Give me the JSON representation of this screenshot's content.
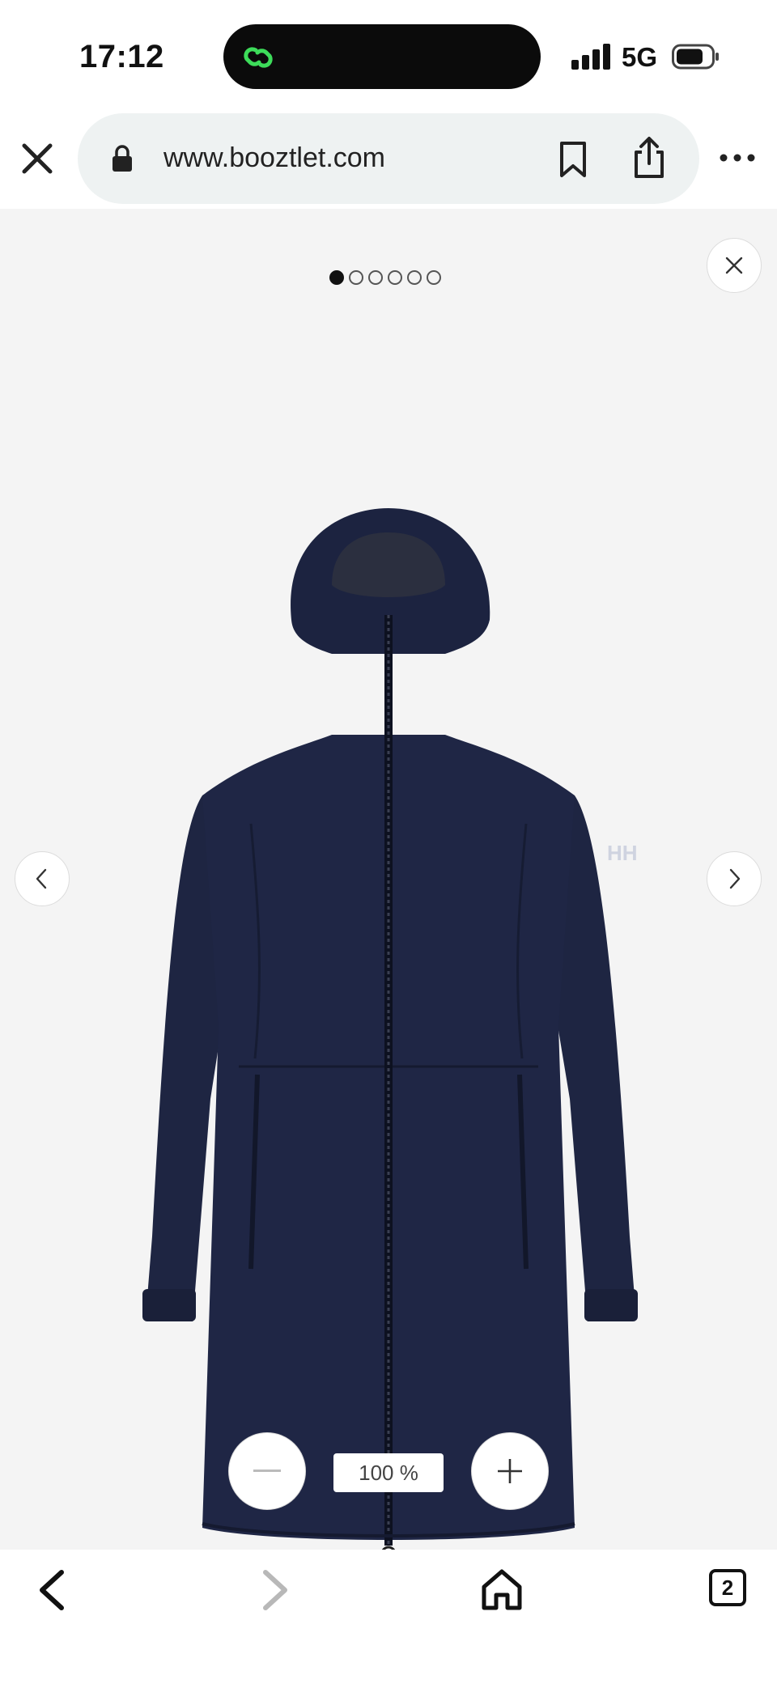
{
  "status_bar": {
    "time": "17:12",
    "network": "5G",
    "icons": [
      "link-icon",
      "signal-icon",
      "battery-icon"
    ]
  },
  "browser": {
    "url": "www.booztlet.com",
    "icons": [
      "close-icon",
      "lock-icon",
      "bookmark-icon",
      "share-icon",
      "more-icon"
    ]
  },
  "gallery": {
    "image_count": 6,
    "active_index": 0,
    "zoom_level": "100 %",
    "product_image": "navy-hooded-parka-jacket",
    "icons": [
      "close-icon",
      "chevron-left-icon",
      "chevron-right-icon",
      "minus-icon",
      "plus-icon"
    ]
  },
  "toolbar": {
    "tab_count": "2",
    "icons": [
      "back-icon",
      "forward-icon",
      "home-icon",
      "tabs-icon"
    ]
  },
  "colors": {
    "gallery_bg": "#f4f4f4",
    "url_pill_bg": "#eef2f2",
    "jacket_navy": "#1d2440",
    "island_accent": "#3ddc5a"
  }
}
